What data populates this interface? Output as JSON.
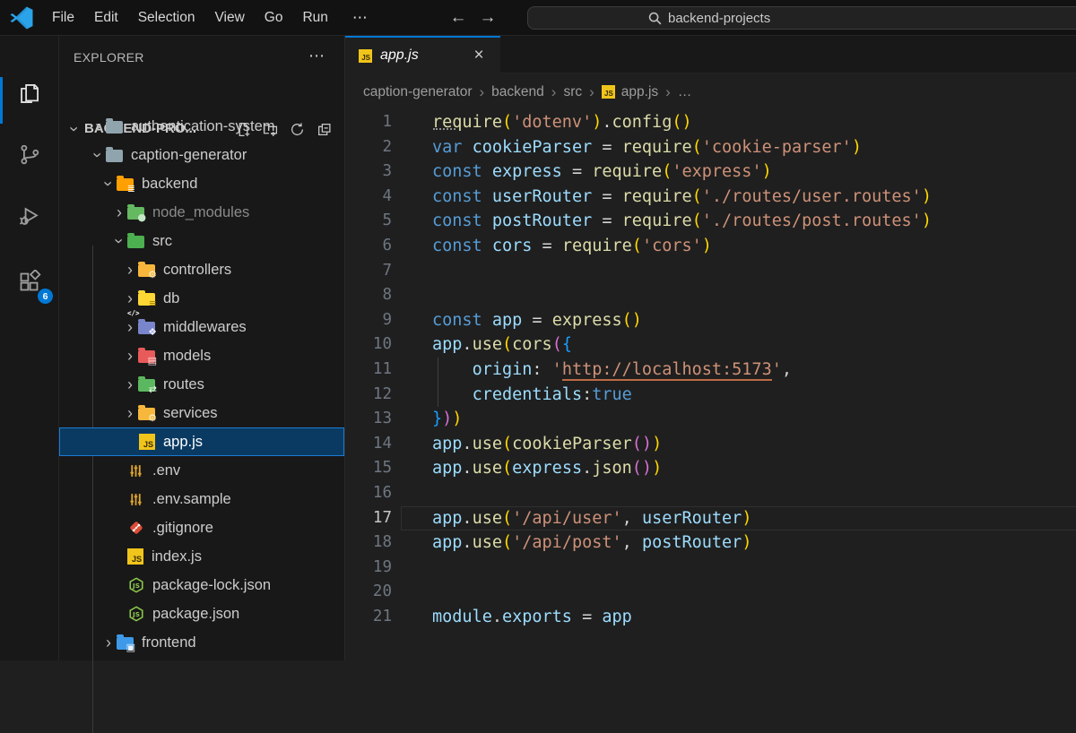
{
  "title_bar": {
    "menus": [
      "File",
      "Edit",
      "Selection",
      "View",
      "Go",
      "Run"
    ],
    "more_glyph": "⋯",
    "back_glyph": "←",
    "forward_glyph": "→",
    "search": {
      "value": "backend-projects"
    }
  },
  "activity_bar": {
    "items": [
      {
        "name": "explorer",
        "active": true
      },
      {
        "name": "source-control"
      },
      {
        "name": "run-and-debug"
      },
      {
        "name": "extensions",
        "badge": "6"
      }
    ]
  },
  "sidebar": {
    "title": "EXPLORER",
    "more_glyph": "⋯",
    "section_label": "BACKEND-PRO...",
    "tree": [
      {
        "label": "authentication-system"
      },
      {
        "label": "caption-generator"
      },
      {
        "label": "backend"
      },
      {
        "label": "node_modules"
      },
      {
        "label": "src"
      },
      {
        "label": "controllers"
      },
      {
        "label": "db"
      },
      {
        "label": "middlewares"
      },
      {
        "label": "models"
      },
      {
        "label": "routes"
      },
      {
        "label": "services"
      },
      {
        "label": "app.js",
        "selected": true
      },
      {
        "label": ".env"
      },
      {
        "label": ".env.sample"
      },
      {
        "label": ".gitignore"
      },
      {
        "label": "index.js"
      },
      {
        "label": "package-lock.json"
      },
      {
        "label": "package.json"
      },
      {
        "label": "frontend"
      }
    ]
  },
  "editor": {
    "tab": {
      "label": "app.js"
    },
    "breadcrumbs": {
      "items": [
        "caption-generator",
        "backend",
        "src"
      ],
      "file": "app.js",
      "more": "…"
    },
    "code": {
      "lines": [
        {
          "n": "1",
          "t": [
            [
              "fn u-hint",
              "require"
            ],
            [
              "b1",
              "("
            ],
            [
              "str",
              "'dotenv'"
            ],
            [
              "b1",
              ")"
            ],
            [
              "op",
              "."
            ],
            [
              "fn",
              "config"
            ],
            [
              "b1",
              "()"
            ]
          ]
        },
        {
          "n": "2",
          "t": [
            [
              "kw",
              "var"
            ],
            [
              "ws",
              " "
            ],
            [
              "var",
              "cookieParser"
            ],
            [
              "op",
              " = "
            ],
            [
              "fn",
              "require"
            ],
            [
              "b1",
              "("
            ],
            [
              "str",
              "'cookie-parser'"
            ],
            [
              "b1",
              ")"
            ]
          ]
        },
        {
          "n": "3",
          "t": [
            [
              "kw",
              "const"
            ],
            [
              "ws",
              " "
            ],
            [
              "var",
              "express"
            ],
            [
              "op",
              " = "
            ],
            [
              "fn",
              "require"
            ],
            [
              "b1",
              "("
            ],
            [
              "str",
              "'express'"
            ],
            [
              "b1",
              ")"
            ]
          ]
        },
        {
          "n": "4",
          "t": [
            [
              "kw",
              "const"
            ],
            [
              "ws",
              " "
            ],
            [
              "var",
              "userRouter"
            ],
            [
              "op",
              " = "
            ],
            [
              "fn",
              "require"
            ],
            [
              "b1",
              "("
            ],
            [
              "str",
              "'./routes/user.routes'"
            ],
            [
              "b1",
              ")"
            ]
          ]
        },
        {
          "n": "5",
          "t": [
            [
              "kw",
              "const"
            ],
            [
              "ws",
              " "
            ],
            [
              "var",
              "postRouter"
            ],
            [
              "op",
              " = "
            ],
            [
              "fn",
              "require"
            ],
            [
              "b1",
              "("
            ],
            [
              "str",
              "'./routes/post.routes'"
            ],
            [
              "b1",
              ")"
            ]
          ]
        },
        {
          "n": "6",
          "t": [
            [
              "kw",
              "const"
            ],
            [
              "ws",
              " "
            ],
            [
              "var",
              "cors"
            ],
            [
              "op",
              " = "
            ],
            [
              "fn",
              "require"
            ],
            [
              "b1",
              "("
            ],
            [
              "str",
              "'cors'"
            ],
            [
              "b1",
              ")"
            ]
          ]
        },
        {
          "n": "7",
          "t": []
        },
        {
          "n": "8",
          "t": []
        },
        {
          "n": "9",
          "t": [
            [
              "kw",
              "const"
            ],
            [
              "ws",
              " "
            ],
            [
              "var",
              "app"
            ],
            [
              "op",
              " = "
            ],
            [
              "fn",
              "express"
            ],
            [
              "b1",
              "()"
            ]
          ]
        },
        {
          "n": "10",
          "t": [
            [
              "var",
              "app"
            ],
            [
              "op",
              "."
            ],
            [
              "fn",
              "use"
            ],
            [
              "b1",
              "("
            ],
            [
              "fn",
              "cors"
            ],
            [
              "b2",
              "("
            ],
            [
              "b3",
              "{"
            ]
          ]
        },
        {
          "n": "11",
          "g": true,
          "t": [
            [
              "ws",
              "    "
            ],
            [
              "var",
              "origin"
            ],
            [
              "op",
              ": "
            ],
            [
              "str",
              "'"
            ],
            [
              "str link",
              "http://localhost:5173"
            ],
            [
              "str",
              "'"
            ],
            [
              "op",
              ","
            ]
          ]
        },
        {
          "n": "12",
          "g": true,
          "t": [
            [
              "ws",
              "    "
            ],
            [
              "var",
              "credentials"
            ],
            [
              "op",
              ":"
            ],
            [
              "kw",
              "true"
            ]
          ]
        },
        {
          "n": "13",
          "t": [
            [
              "b3",
              "}"
            ],
            [
              "b2",
              ")"
            ],
            [
              "b1",
              ")"
            ]
          ]
        },
        {
          "n": "14",
          "t": [
            [
              "var",
              "app"
            ],
            [
              "op",
              "."
            ],
            [
              "fn",
              "use"
            ],
            [
              "b1",
              "("
            ],
            [
              "fn",
              "cookieParser"
            ],
            [
              "b2",
              "()"
            ],
            [
              "b1",
              ")"
            ]
          ]
        },
        {
          "n": "15",
          "t": [
            [
              "var",
              "app"
            ],
            [
              "op",
              "."
            ],
            [
              "fn",
              "use"
            ],
            [
              "b1",
              "("
            ],
            [
              "var",
              "express"
            ],
            [
              "op",
              "."
            ],
            [
              "fn",
              "json"
            ],
            [
              "b2",
              "()"
            ],
            [
              "b1",
              ")"
            ]
          ]
        },
        {
          "n": "16",
          "t": []
        },
        {
          "n": "17",
          "active": true,
          "t": [
            [
              "var",
              "app"
            ],
            [
              "op",
              "."
            ],
            [
              "fn",
              "use"
            ],
            [
              "b1",
              "("
            ],
            [
              "str",
              "'/api/user'"
            ],
            [
              "op",
              ", "
            ],
            [
              "var",
              "userRouter"
            ],
            [
              "b1",
              ")"
            ]
          ]
        },
        {
          "n": "18",
          "t": [
            [
              "var",
              "app"
            ],
            [
              "op",
              "."
            ],
            [
              "fn",
              "use"
            ],
            [
              "b1",
              "("
            ],
            [
              "str",
              "'/api/post'"
            ],
            [
              "op",
              ", "
            ],
            [
              "var",
              "postRouter"
            ],
            [
              "b1",
              ")"
            ]
          ]
        },
        {
          "n": "19",
          "t": []
        },
        {
          "n": "20",
          "t": []
        },
        {
          "n": "21",
          "t": [
            [
              "var",
              "module"
            ],
            [
              "op",
              "."
            ],
            [
              "var",
              "exports"
            ],
            [
              "op",
              " = "
            ],
            [
              "var",
              "app"
            ]
          ]
        }
      ]
    }
  },
  "colors": {
    "accent": "#0078d4",
    "selection_bg": "#0a3a62",
    "selection_border": "#1c7bd4",
    "badge": "#0078d4"
  }
}
